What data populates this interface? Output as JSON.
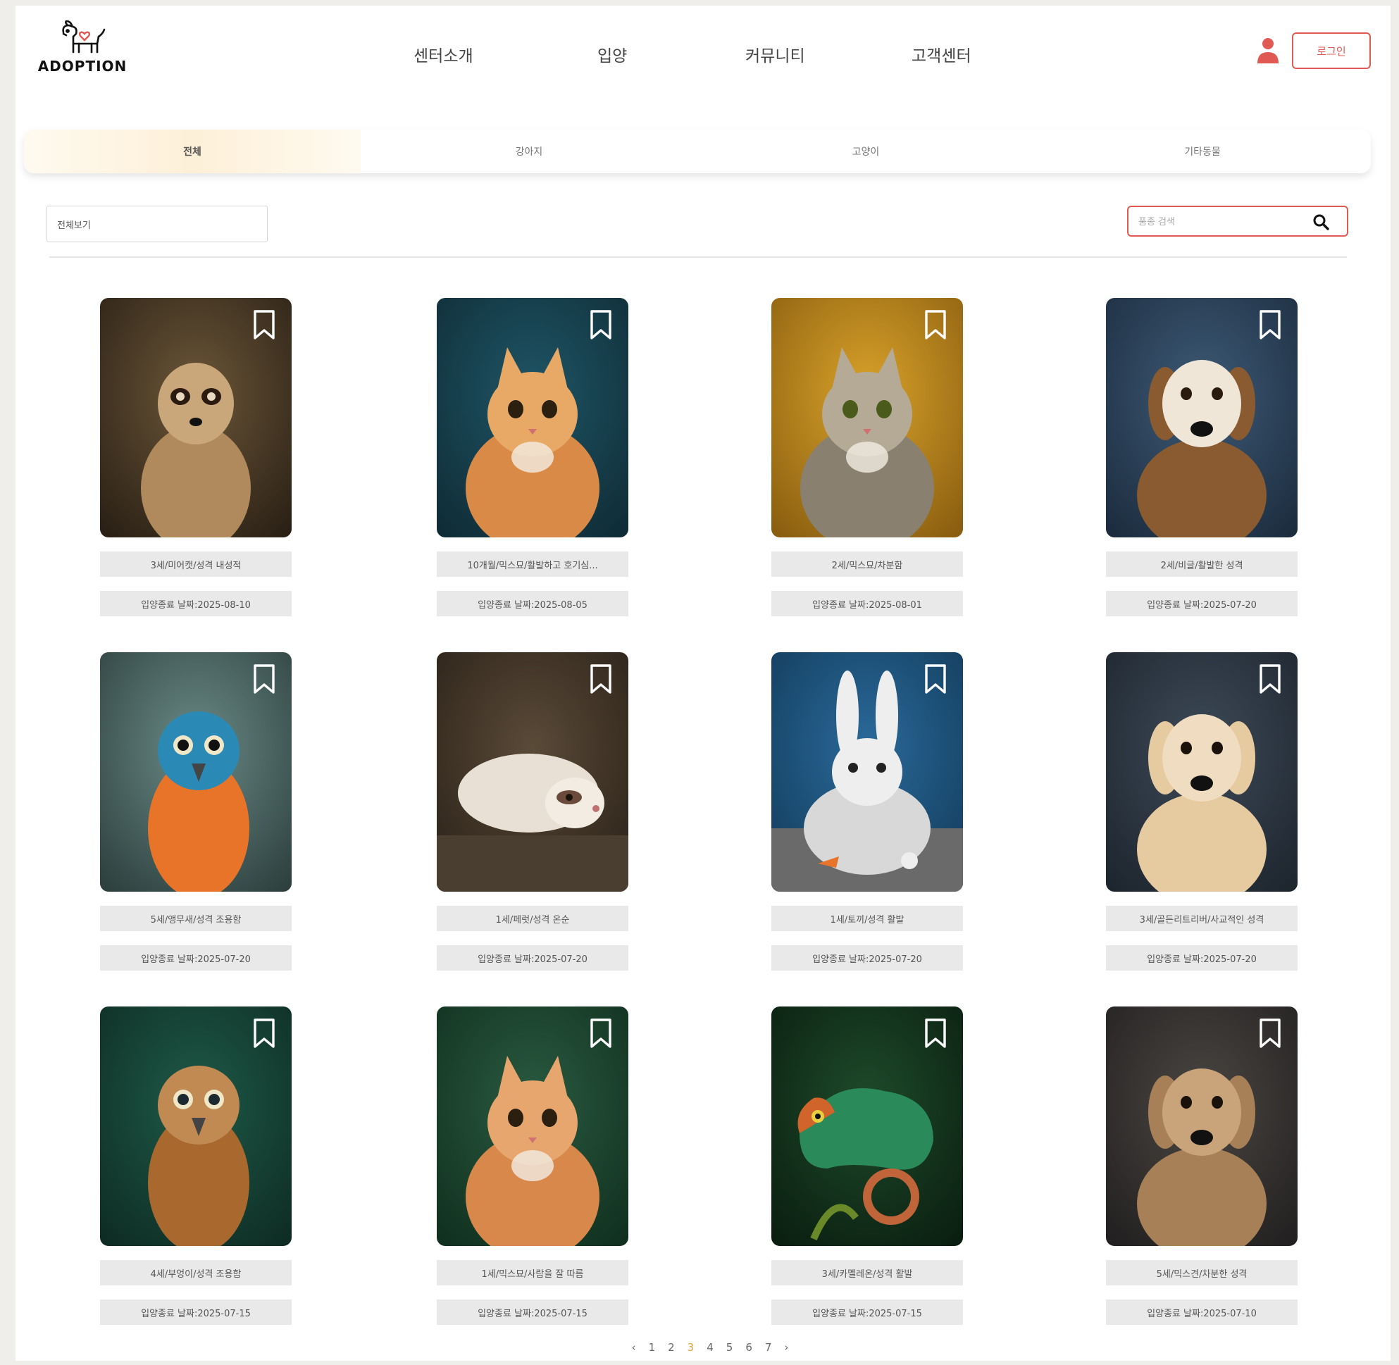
{
  "brand": {
    "name": "ADOPTION"
  },
  "nav": [
    {
      "label": "센터소개"
    },
    {
      "label": "입양"
    },
    {
      "label": "커뮤니티"
    },
    {
      "label": "고객센터"
    }
  ],
  "header": {
    "login_label": "로그인"
  },
  "tabs": [
    {
      "label": "전체",
      "active": true
    },
    {
      "label": "강아지",
      "active": false
    },
    {
      "label": "고양이",
      "active": false
    },
    {
      "label": "기타동물",
      "active": false
    }
  ],
  "filter": {
    "selected": "전체보기"
  },
  "search": {
    "placeholder": "품종 검색"
  },
  "cards": [
    {
      "info": "3세/미어캣/성격 내성적",
      "date": "입양종료 날짜:2025-08-10",
      "animal": "meerkat"
    },
    {
      "info": "10개월/믹스묘/활발하고 호기심...",
      "date": "입양종료 날짜:2025-08-05",
      "animal": "cat-orange"
    },
    {
      "info": "2세/믹스묘/차분함",
      "date": "입양종료 날짜:2025-08-01",
      "animal": "cat-tabby"
    },
    {
      "info": "2세/비글/활발한 성격",
      "date": "입양종료 날짜:2025-07-20",
      "animal": "beagle"
    },
    {
      "info": "5세/앵무새/성격 조용함",
      "date": "입양종료 날짜:2025-07-20",
      "animal": "parrot"
    },
    {
      "info": "1세/페럿/성격 온순",
      "date": "입양종료 날짜:2025-07-20",
      "animal": "ferret"
    },
    {
      "info": "1세/토끼/성격 활발",
      "date": "입양종료 날짜:2025-07-20",
      "animal": "rabbit"
    },
    {
      "info": "3세/골든리트리버/사교적인 성격",
      "date": "입양종료 날짜:2025-07-20",
      "animal": "golden-retriever"
    },
    {
      "info": "4세/부엉이/성격 조용함",
      "date": "입양종료 날짜:2025-07-15",
      "animal": "owl"
    },
    {
      "info": "1세/믹스묘/사람을 잘 따름",
      "date": "입양종료 날짜:2025-07-15",
      "animal": "cat-ginger"
    },
    {
      "info": "3세/카멜레온/성격 활발",
      "date": "입양종료 날짜:2025-07-15",
      "animal": "chameleon"
    },
    {
      "info": "5세/믹스견/차분한 성격",
      "date": "입양종료 날짜:2025-07-10",
      "animal": "mixed-dog"
    }
  ],
  "pagination": {
    "prev": "‹",
    "next": "›",
    "pages": [
      "1",
      "2",
      "3",
      "4",
      "5",
      "6",
      "7"
    ],
    "current": "3"
  },
  "colors": {
    "accent": "#e05a53",
    "current_page": "#e8a23a"
  }
}
